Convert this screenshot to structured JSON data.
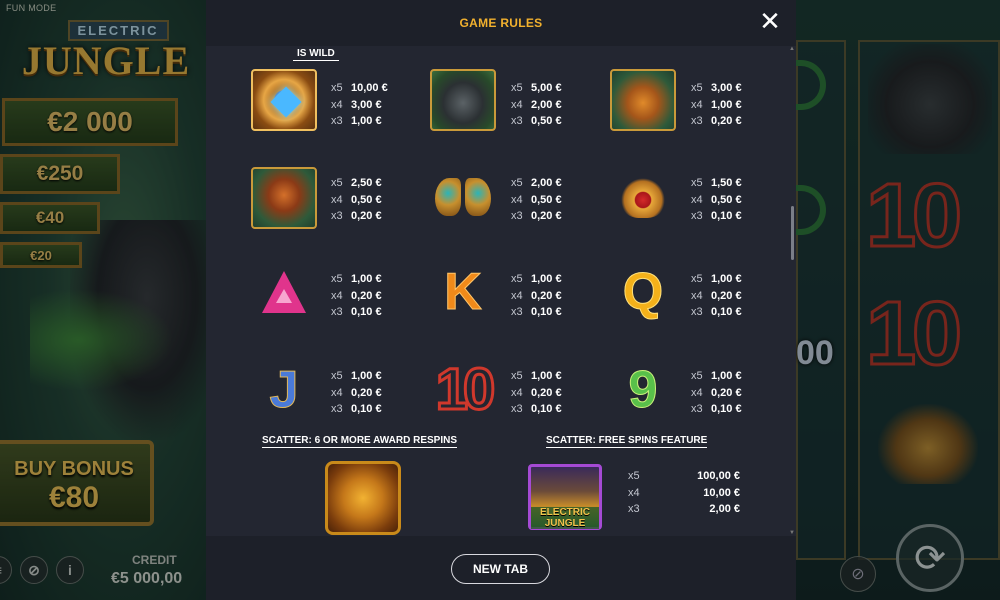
{
  "background": {
    "mode_label": "FUN MODE",
    "logo_line1": "ELECTRIC",
    "logo_line2": "JUNGLE",
    "jackpots": [
      "€2 000",
      "€250",
      "€40",
      "€20"
    ],
    "buy_bonus_label": "BUY BONUS",
    "buy_bonus_price": "€80",
    "credit_label": "CREDIT",
    "credit_value": "€5 000,00",
    "peek_text": "00"
  },
  "modal": {
    "title": "GAME RULES",
    "close_glyph": "✕",
    "wild_label": "IS WILD",
    "footer_button": "NEW TAB"
  },
  "paytable": [
    {
      "symbol": "wild",
      "icon": "blue-gem-wild-icon",
      "x5": "10,00 €",
      "x4": "3,00 €",
      "x3": "1,00 €"
    },
    {
      "symbol": "gorilla",
      "icon": "gorilla-icon",
      "x5": "5,00 €",
      "x4": "2,00 €",
      "x3": "0,50 €"
    },
    {
      "symbol": "tiger",
      "icon": "tiger-icon",
      "x5": "3,00 €",
      "x4": "1,00 €",
      "x3": "0,20 €"
    },
    {
      "symbol": "kangaroo",
      "icon": "kangaroo-icon",
      "x5": "2,50 €",
      "x4": "0,50 €",
      "x3": "0,20 €"
    },
    {
      "symbol": "butterfly",
      "icon": "butterfly-icon",
      "x5": "2,00 €",
      "x4": "0,50 €",
      "x3": "0,20 €"
    },
    {
      "symbol": "lotus",
      "icon": "lotus-icon",
      "x5": "1,50 €",
      "x4": "0,50 €",
      "x3": "0,10 €"
    },
    {
      "symbol": "A",
      "icon": "letter-a-icon",
      "x5": "1,00 €",
      "x4": "0,20 €",
      "x3": "0,10 €"
    },
    {
      "symbol": "K",
      "icon": "letter-k-icon",
      "x5": "1,00 €",
      "x4": "0,20 €",
      "x3": "0,10 €"
    },
    {
      "symbol": "Q",
      "icon": "letter-q-icon",
      "x5": "1,00 €",
      "x4": "0,20 €",
      "x3": "0,10 €"
    },
    {
      "symbol": "J",
      "icon": "letter-j-icon",
      "x5": "1,00 €",
      "x4": "0,20 €",
      "x3": "0,10 €"
    },
    {
      "symbol": "10",
      "icon": "number-10-icon",
      "x5": "1,00 €",
      "x4": "0,20 €",
      "x3": "0,10 €"
    },
    {
      "symbol": "9",
      "icon": "number-9-icon",
      "x5": "1,00 €",
      "x4": "0,20 €",
      "x3": "0,10 €"
    }
  ],
  "multipliers": {
    "m5": "x5",
    "m4": "x4",
    "m3": "x3"
  },
  "letters": {
    "k": "K",
    "q": "Q",
    "j": "J",
    "ten": "10",
    "nine": "9"
  },
  "scatter_respins": {
    "title": "SCATTER: 6 OR MORE AWARD RESPINS",
    "icon": "gorilla-scatter-icon"
  },
  "scatter_free_spins": {
    "title": "SCATTER: FREE SPINS FEATURE",
    "icon": "temple-scatter-icon",
    "logo_text": "ELECTRIC JUNGLE",
    "x5": "100,00 €",
    "x4": "10,00 €",
    "x3": "2,00 €"
  },
  "colors": {
    "modal_bg": "#232631",
    "header_bg": "#1d2029",
    "title_accent": "#f2b12e"
  }
}
